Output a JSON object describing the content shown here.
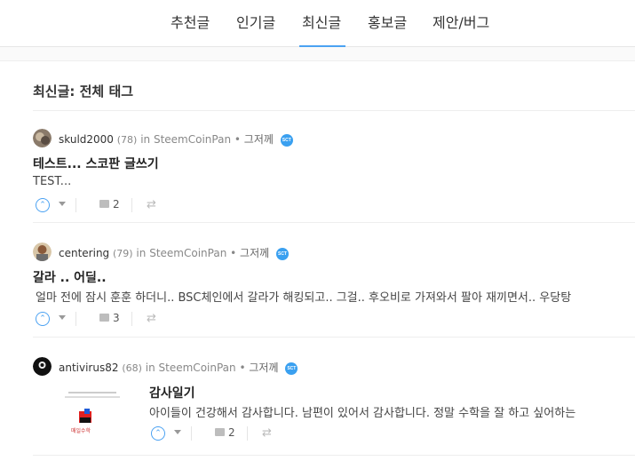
{
  "tabs": [
    {
      "label": "추천글"
    },
    {
      "label": "인기글"
    },
    {
      "label": "최신글",
      "active": true
    },
    {
      "label": "홍보글"
    },
    {
      "label": "제안/버그"
    }
  ],
  "page_title": "최신글: 전체 태그",
  "posts": [
    {
      "author": "skuld2000",
      "reputation": "(78)",
      "in_label": "in",
      "community": "SteemCoinPan",
      "dot": "•",
      "time": "그저께",
      "badge": "SCT",
      "title": "테스트... 스코판 글쓰기",
      "body": "TEST...",
      "comments": "2"
    },
    {
      "author": "centering",
      "reputation": "(79)",
      "in_label": "in",
      "community": "SteemCoinPan",
      "dot": "•",
      "time": "그저께",
      "badge": "SCT",
      "title": "갈라 .. 어딜..",
      "body": "얼마 전에 잠시 훈훈 하더니.. BSC체인에서 갈라가 해킹되고.. 그걸.. 후오비로 가져와서 팔아 재끼면서.. 우당탕",
      "comments": "3"
    },
    {
      "author": "antivirus82",
      "reputation": "(68)",
      "in_label": "in",
      "community": "SteemCoinPan",
      "dot": "•",
      "time": "그저께",
      "badge": "SCT",
      "title": "감사일기",
      "body": "아이들이 건강해서 감사합니다. 남편이 있어서 감사합니다. 정말 수학을 잘 하고 싶어하는",
      "comments": "2",
      "thumb_caption": "매일수학"
    }
  ],
  "colors": {
    "accent": "#4ba2f2",
    "badge": "#3aa0f0"
  }
}
